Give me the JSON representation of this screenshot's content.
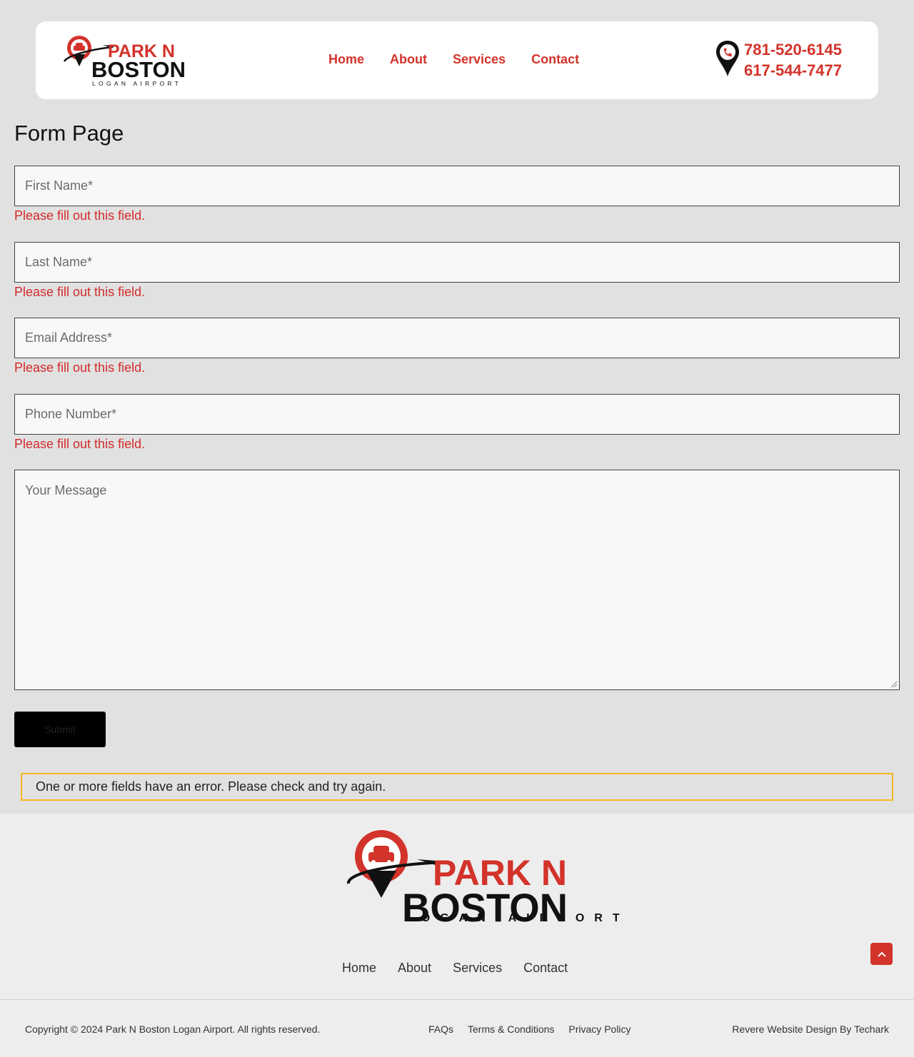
{
  "brand": {
    "name_line1": "PARK N",
    "name_line2": "BOSTON",
    "tagline": "LOGAN AIRPORT",
    "colors": {
      "accent": "#d2332a",
      "dark": "#111111",
      "alert_border": "#f4b91d",
      "error_text": "#d32a2a"
    }
  },
  "header": {
    "nav": [
      {
        "label": "Home"
      },
      {
        "label": "About"
      },
      {
        "label": "Services"
      },
      {
        "label": "Contact"
      }
    ],
    "phone_icon": "phone-pin-icon",
    "phones": [
      "781-520-6145",
      "617-544-7477"
    ]
  },
  "page": {
    "title": "Form Page"
  },
  "form": {
    "fields": [
      {
        "placeholder": "First Name*",
        "error": "Please fill out this field."
      },
      {
        "placeholder": "Last Name*",
        "error": "Please fill out this field."
      },
      {
        "placeholder": "Email Address*",
        "error": "Please fill out this field."
      },
      {
        "placeholder": "Phone Number*",
        "error": "Please fill out this field."
      }
    ],
    "message_placeholder": "Your Message",
    "submit_label": "Submit",
    "alert": "One or more fields have an error. Please check and try again."
  },
  "footer": {
    "nav": [
      {
        "label": "Home"
      },
      {
        "label": "About"
      },
      {
        "label": "Services"
      },
      {
        "label": "Contact"
      }
    ],
    "scroll_top_icon": "chevron-up-icon",
    "copyright": "Copyright © 2024 Park N Boston Logan Airport. All rights reserved.",
    "legal_links": [
      {
        "label": "FAQs"
      },
      {
        "label": "Terms & Conditions"
      },
      {
        "label": "Privacy Policy"
      }
    ],
    "credit": "Revere Website Design By Techark"
  }
}
